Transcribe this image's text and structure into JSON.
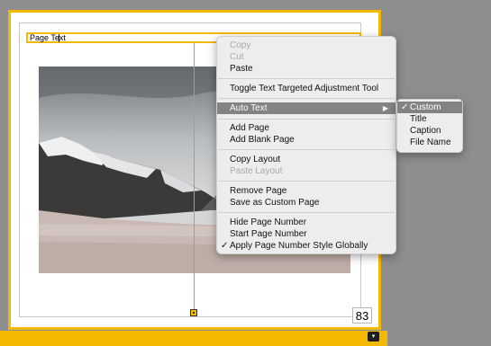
{
  "page": {
    "text_box_value": "Page Text",
    "page_number": "83"
  },
  "context_menu": {
    "items": [
      {
        "label": "Copy"
      },
      {
        "label": "Cut"
      },
      {
        "label": "Paste"
      },
      {
        "label": "Toggle Text Targeted Adjustment Tool"
      },
      {
        "label": "Auto Text",
        "arrow": "▶"
      },
      {
        "label": "Add Page"
      },
      {
        "label": "Add Blank Page"
      },
      {
        "label": "Copy Layout"
      },
      {
        "label": "Paste Layout"
      },
      {
        "label": "Remove Page"
      },
      {
        "label": "Save as Custom Page"
      },
      {
        "label": "Hide Page Number"
      },
      {
        "label": "Start Page Number"
      },
      {
        "label": "Apply Page Number Style Globally",
        "check": "✓"
      }
    ]
  },
  "submenu": {
    "items": [
      {
        "label": "Custom",
        "check": "✓"
      },
      {
        "label": "Title"
      },
      {
        "label": "Caption"
      },
      {
        "label": "File Name"
      }
    ]
  },
  "bottom_bar": {
    "button_glyph": "▾"
  },
  "colors": {
    "accent": "#f5b800",
    "menu_highlight": "#838383",
    "canvas": "#8e8e8e"
  }
}
